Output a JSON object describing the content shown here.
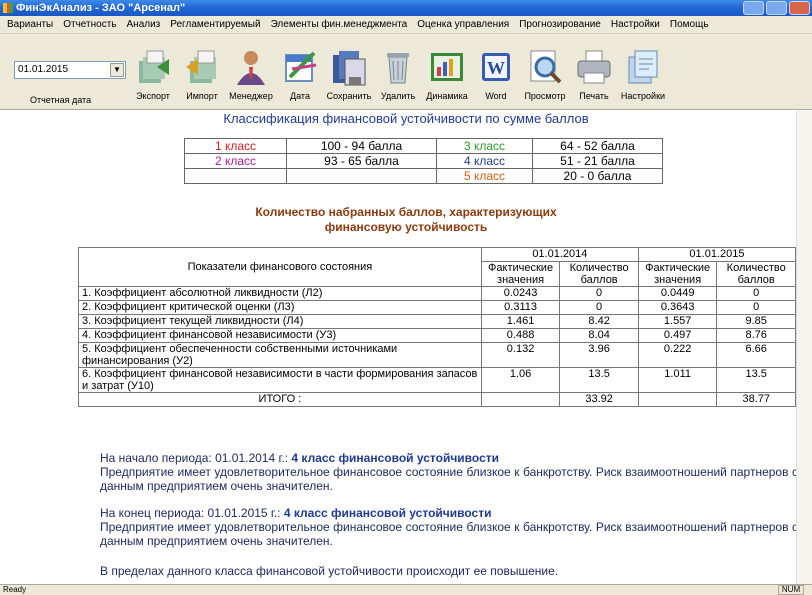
{
  "window": {
    "title": "ФинЭкАнализ - ЗАО \"Арсенал\""
  },
  "menu": [
    "Варианты",
    "Отчетность",
    "Анализ",
    "Регламентируемый",
    "Элементы фин.менеджмента",
    "Оценка управления",
    "Прогнозирование",
    "Настройки",
    "Помощь"
  ],
  "toolbar": {
    "date_value": "01.01.2015",
    "date_caption": "Отчетная дата",
    "tools": [
      {
        "label": "Экспорт",
        "icon": "export-icon"
      },
      {
        "label": "Импорт",
        "icon": "import-icon"
      },
      {
        "label": "Менеджер",
        "icon": "manager-icon"
      },
      {
        "label": "Дата",
        "icon": "date-icon"
      },
      {
        "label": "Сохранить",
        "icon": "save-icon"
      },
      {
        "label": "Удалить",
        "icon": "delete-icon"
      },
      {
        "label": "Динамика",
        "icon": "dynamics-icon"
      },
      {
        "label": "Word",
        "icon": "word-icon"
      },
      {
        "label": "Просмотр",
        "icon": "preview-icon"
      },
      {
        "label": "Печать",
        "icon": "print-icon"
      },
      {
        "label": "Настройки",
        "icon": "settings-icon"
      }
    ]
  },
  "classification": {
    "title": "Классификация финансовой устойчивости по сумме баллов",
    "rows": [
      {
        "c1": "1 класс",
        "r1": "100 - 94 балла",
        "c2": "3 класс",
        "r2": "64 - 52 балла"
      },
      {
        "c1": "2 класс",
        "r1": "93 - 65 балла",
        "c2": "4 класс",
        "r2": "51 - 21 балла"
      },
      {
        "c1": "",
        "r1": "",
        "c2": "5 класс",
        "r2": "20 - 0 балла"
      }
    ]
  },
  "scores": {
    "title_line1": "Количество набранных баллов, характеризующих",
    "title_line2": "финансовую устойчивость",
    "header_indicator": "Показатели финансового состояния",
    "period1": "01.01.2014",
    "period2": "01.01.2015",
    "col_actual": "Фактические значения",
    "col_points": "Количество баллов",
    "rows": [
      {
        "name": "1. Коэффициент абсолютной ликвидности (Л2)",
        "a1": "0.0243",
        "p1": "0",
        "a2": "0.0449",
        "p2": "0"
      },
      {
        "name": "2. Коэффициент критической оценки (Л3)",
        "a1": "0.3113",
        "p1": "0",
        "a2": "0.3643",
        "p2": "0"
      },
      {
        "name": "3. Коэффициент текущей ликвидности (Л4)",
        "a1": "1.461",
        "p1": "8.42",
        "a2": "1.557",
        "p2": "9.85"
      },
      {
        "name": "4. Коэффициент финансовой независимости (У3)",
        "a1": "0.488",
        "p1": "8.04",
        "a2": "0.497",
        "p2": "8.76"
      },
      {
        "name": "5. Коэффициент обеспеченности собственными источниками финансирования (У2)",
        "a1": "0.132",
        "p1": "3.96",
        "a2": "0.222",
        "p2": "6.66"
      },
      {
        "name": "6. Коэффициент финансовой независимости в части формирования запасов и затрат (У10)",
        "a1": "1.06",
        "p1": "13.5",
        "a2": "1.011",
        "p2": "13.5"
      }
    ],
    "total_label": "ИТОГО :",
    "total1": "33.92",
    "total2": "38.77"
  },
  "conclusions": {
    "start_prefix": "На начало периода: 01.01.2014 г.:",
    "start_class": "4 класс финансовой устойчивости",
    "start_text": "Предприятие имеет удовлетворительное финансовое состояние близкое к банкротству. Риск взаимоотношений партнеров с данным предприятием очень значителен.",
    "end_prefix": "На конец периода: 01.01.2015 г.:",
    "end_class": "4 класс финансовой устойчивости",
    "end_text": "Предприятие имеет удовлетворительное финансовое состояние близкое к банкротству. Риск взаимоотношений партнеров с данным предприятием очень значителен.",
    "trend": "В пределах данного класса финансовой устойчивости происходит ее повышение."
  },
  "status": {
    "text": "Ready",
    "num": "NUM"
  }
}
